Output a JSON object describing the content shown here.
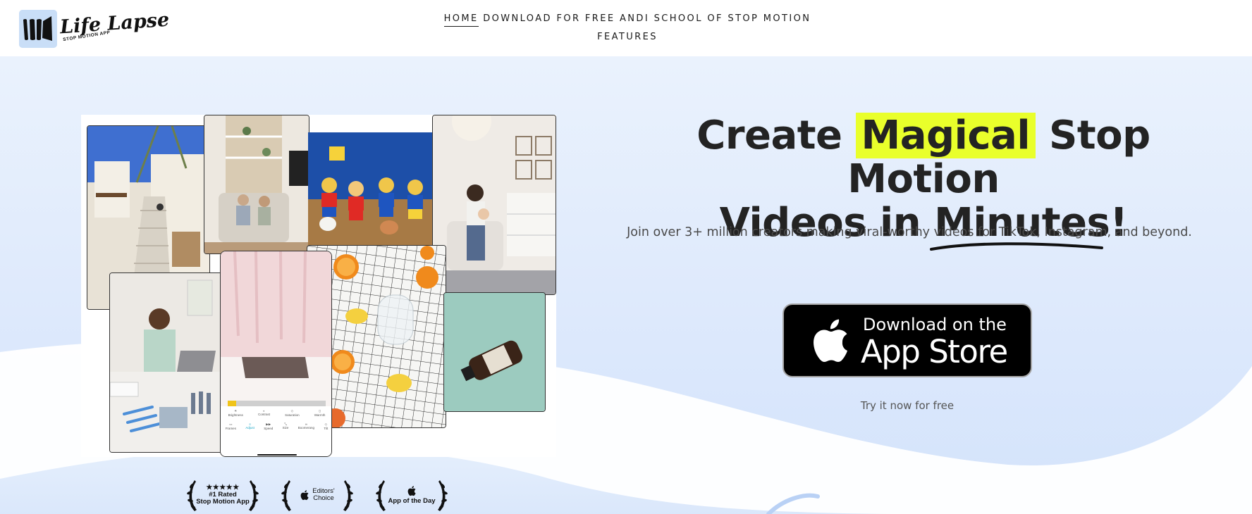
{
  "brand": {
    "name": "Life Lapse",
    "tagline": "STOP MOTION APP"
  },
  "nav": {
    "items": [
      {
        "label": "HOME",
        "active": true
      },
      {
        "label": "DOWNLOAD FOR FREE",
        "active": false
      },
      {
        "label": "ANDI",
        "active": false
      },
      {
        "label": "SCHOOL OF STOP MOTION",
        "active": false
      },
      {
        "label": "FEATURES",
        "active": false
      }
    ]
  },
  "hero": {
    "title_part1": "Create",
    "title_highlight": "Magical",
    "title_part2": "Stop Motion",
    "title_line2_start": "Videos in",
    "title_underlined": "Minutes",
    "title_end": "!",
    "subtitle": "Join over 3+ million creators making viral-worthy videos for TikTok, Instagram, and beyond.",
    "cta_line1": "Download on the",
    "cta_line2": "App Store",
    "cta_note": "Try it now for free",
    "highlight_color": "#e9ff2b"
  },
  "editor_panel": {
    "adjustments": [
      "Brightness",
      "Contrast",
      "Saturation",
      "Warmth"
    ],
    "tools": [
      "Frames",
      "Adjust",
      "Speed",
      "Size",
      "Boomerang",
      "Tilt"
    ]
  },
  "awards": [
    {
      "stars": "★★★★★",
      "line1": "#1 Rated",
      "line2": "Stop Motion App"
    },
    {
      "icon": "apple-icon",
      "line1": "Editors'",
      "line2": "Choice"
    },
    {
      "icon": "apple-icon",
      "line1": "App of the Day",
      "line2": ""
    }
  ],
  "colors": {
    "background": "#ffffff",
    "hero_gradient_top": "#eaf2fd",
    "hero_wave": "#ffffff",
    "text": "#232323",
    "cta_bg": "#000000"
  }
}
